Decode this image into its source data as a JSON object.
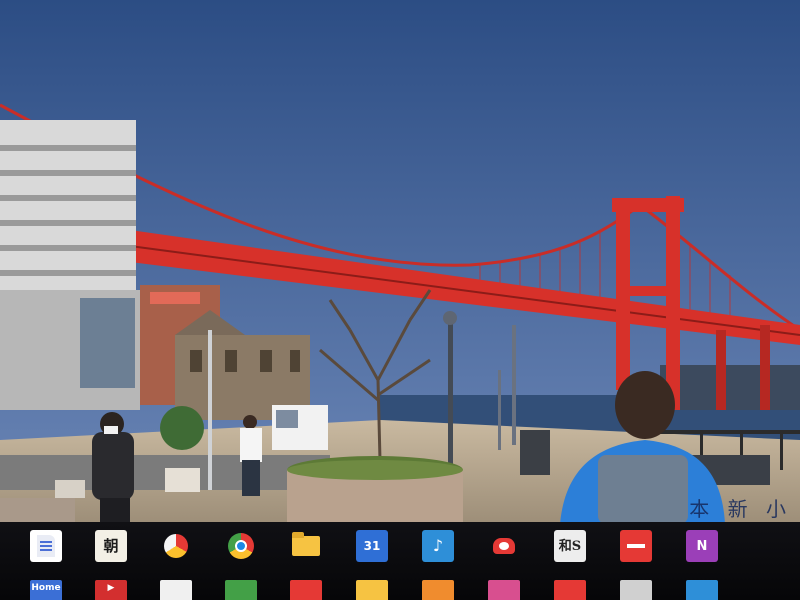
{
  "wallpaper": {
    "description_name": "desktop-wallpaper",
    "caption": "本  新 小",
    "colors": {
      "sky_top": "#2d4f86",
      "sky_bottom": "#5f7fb4",
      "bridge": "#d7312a",
      "water": "#2d4a73"
    }
  },
  "tray": {
    "row1": [
      {
        "name": "google-docs-icon",
        "label": ""
      },
      {
        "name": "asahi-news-icon",
        "label": "朝"
      },
      {
        "name": "photo-camera-icon",
        "label": ""
      },
      {
        "name": "chrome-icon",
        "label": ""
      },
      {
        "name": "file-folder-icon",
        "label": ""
      },
      {
        "name": "calendar-icon",
        "label": "31"
      },
      {
        "name": "cast-icon",
        "label": "♪"
      },
      {
        "name": "ribbon-app-icon",
        "label": ""
      },
      {
        "name": "dictionary-icon",
        "label": "和S"
      },
      {
        "name": "minus-app-icon",
        "label": ""
      },
      {
        "name": "onenote-icon",
        "label": "N"
      }
    ],
    "row2": [
      {
        "name": "home-app-icon",
        "label": "Home"
      },
      {
        "name": "youtube-icon",
        "label": "▶"
      },
      {
        "name": "app-icon-3",
        "label": ""
      },
      {
        "name": "app-icon-4",
        "label": ""
      },
      {
        "name": "app-icon-5",
        "label": ""
      },
      {
        "name": "app-icon-6",
        "label": ""
      },
      {
        "name": "app-icon-7",
        "label": ""
      },
      {
        "name": "app-icon-8",
        "label": ""
      },
      {
        "name": "app-icon-9",
        "label": ""
      },
      {
        "name": "app-icon-10",
        "label": ""
      },
      {
        "name": "app-icon-11",
        "label": ""
      }
    ]
  }
}
